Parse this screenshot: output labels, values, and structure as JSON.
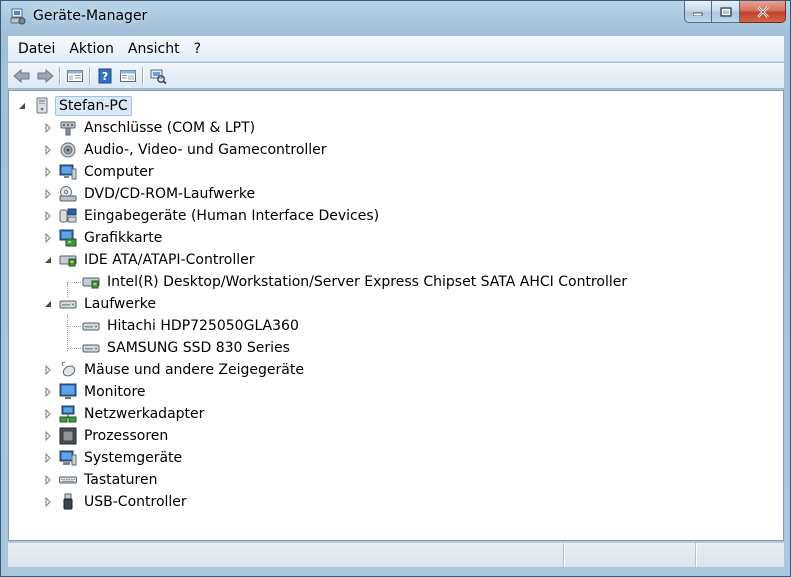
{
  "window": {
    "title": "Geräte-Manager",
    "icon": "device-manager-icon",
    "controls": [
      "minimize-icon",
      "maximize-icon",
      "close-icon"
    ]
  },
  "menu": {
    "items": [
      "Datei",
      "Aktion",
      "Ansicht",
      "?"
    ]
  },
  "toolbar": {
    "buttons": [
      "back-arrow-icon",
      "forward-arrow-icon",
      "show-hide-console-tree-icon",
      "help-icon",
      "properties-icon",
      "scan-hardware-icon"
    ]
  },
  "tree": {
    "root": {
      "label": "Stefan-PC",
      "icon": "computer-icon",
      "expanded": true
    },
    "categories": [
      {
        "label": "Anschlüsse (COM & LPT)",
        "icon": "port-icon",
        "expanded": false
      },
      {
        "label": "Audio-, Video- und Gamecontroller",
        "icon": "speaker-icon",
        "expanded": false
      },
      {
        "label": "Computer",
        "icon": "computer-icon",
        "expanded": false
      },
      {
        "label": "DVD/CD-ROM-Laufwerke",
        "icon": "dvd-drive-icon",
        "expanded": false
      },
      {
        "label": "Eingabegeräte (Human Interface Devices)",
        "icon": "hid-icon",
        "expanded": false
      },
      {
        "label": "Grafikkarte",
        "icon": "display-adapter-icon",
        "expanded": false
      },
      {
        "label": "IDE ATA/ATAPI-Controller",
        "icon": "ide-controller-icon",
        "expanded": true,
        "children": [
          "Intel(R) Desktop/Workstation/Server Express Chipset SATA AHCI Controller"
        ]
      },
      {
        "label": "Laufwerke",
        "icon": "disk-drive-icon",
        "expanded": true,
        "children": [
          "Hitachi HDP725050GLA360",
          "SAMSUNG SSD 830 Series"
        ]
      },
      {
        "label": "Mäuse und andere Zeigegeräte",
        "icon": "mouse-icon",
        "expanded": false
      },
      {
        "label": "Monitore",
        "icon": "monitor-icon",
        "expanded": false
      },
      {
        "label": "Netzwerkadapter",
        "icon": "network-adapter-icon",
        "expanded": false
      },
      {
        "label": "Prozessoren",
        "icon": "processor-icon",
        "expanded": false
      },
      {
        "label": "Systemgeräte",
        "icon": "system-device-icon",
        "expanded": false
      },
      {
        "label": "Tastaturen",
        "icon": "keyboard-icon",
        "expanded": false
      },
      {
        "label": "USB-Controller",
        "icon": "usb-icon",
        "expanded": false
      }
    ]
  },
  "statusbar": {
    "panes": [
      "",
      "",
      ""
    ]
  }
}
